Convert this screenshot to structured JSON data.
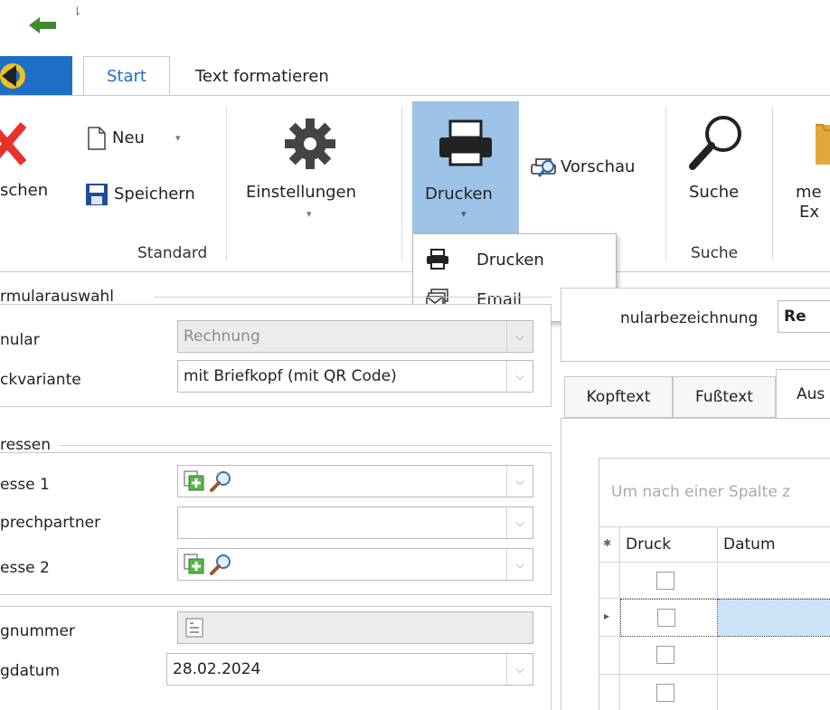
{
  "quick_access": {
    "dropdown_glyph": "⇂"
  },
  "tabs": {
    "start": "Start",
    "text_format": "Text formatieren"
  },
  "ribbon": {
    "delete_label": "schen",
    "new_label": "Neu",
    "save_label": "Speichern",
    "settings_label": "Einstellungen",
    "print_label": "Drucken",
    "preview_label": "Vorschau",
    "search_label": "Suche",
    "more_label_1": "me",
    "more_label_2": "Ex",
    "groups": {
      "standard": "Standard",
      "search": "Suche"
    }
  },
  "print_menu": {
    "items": [
      "Drucken",
      "Email"
    ]
  },
  "form": {
    "section_form": "rmularauswahl",
    "label_form": "nular",
    "form_value": "Rechnung",
    "label_variant": "ckvariante",
    "variant_value": "mit Briefkopf (mit QR Code)",
    "section_address": "ressen",
    "label_address1": "esse 1",
    "label_contact": "prechpartner",
    "label_address2": "esse 2",
    "label_doc_number": "gnummer",
    "label_doc_date": "gdatum",
    "doc_date_value": "28.02.2024"
  },
  "right": {
    "form_name_label": "nularbezeichnung",
    "form_name_value": "Re",
    "subtabs": [
      "Kopftext",
      "Fußtext",
      "Aus"
    ],
    "group_hint": "Um nach einer Spalte z",
    "columns": [
      "Druck",
      "Datum"
    ],
    "asterisk": "✱",
    "row_pointer": "▸"
  },
  "colors": {
    "accent": "#1e6fc8",
    "delete": "#e8312a",
    "print_highlight": "#9dc3e6",
    "selected_row": "#cce3f7"
  }
}
